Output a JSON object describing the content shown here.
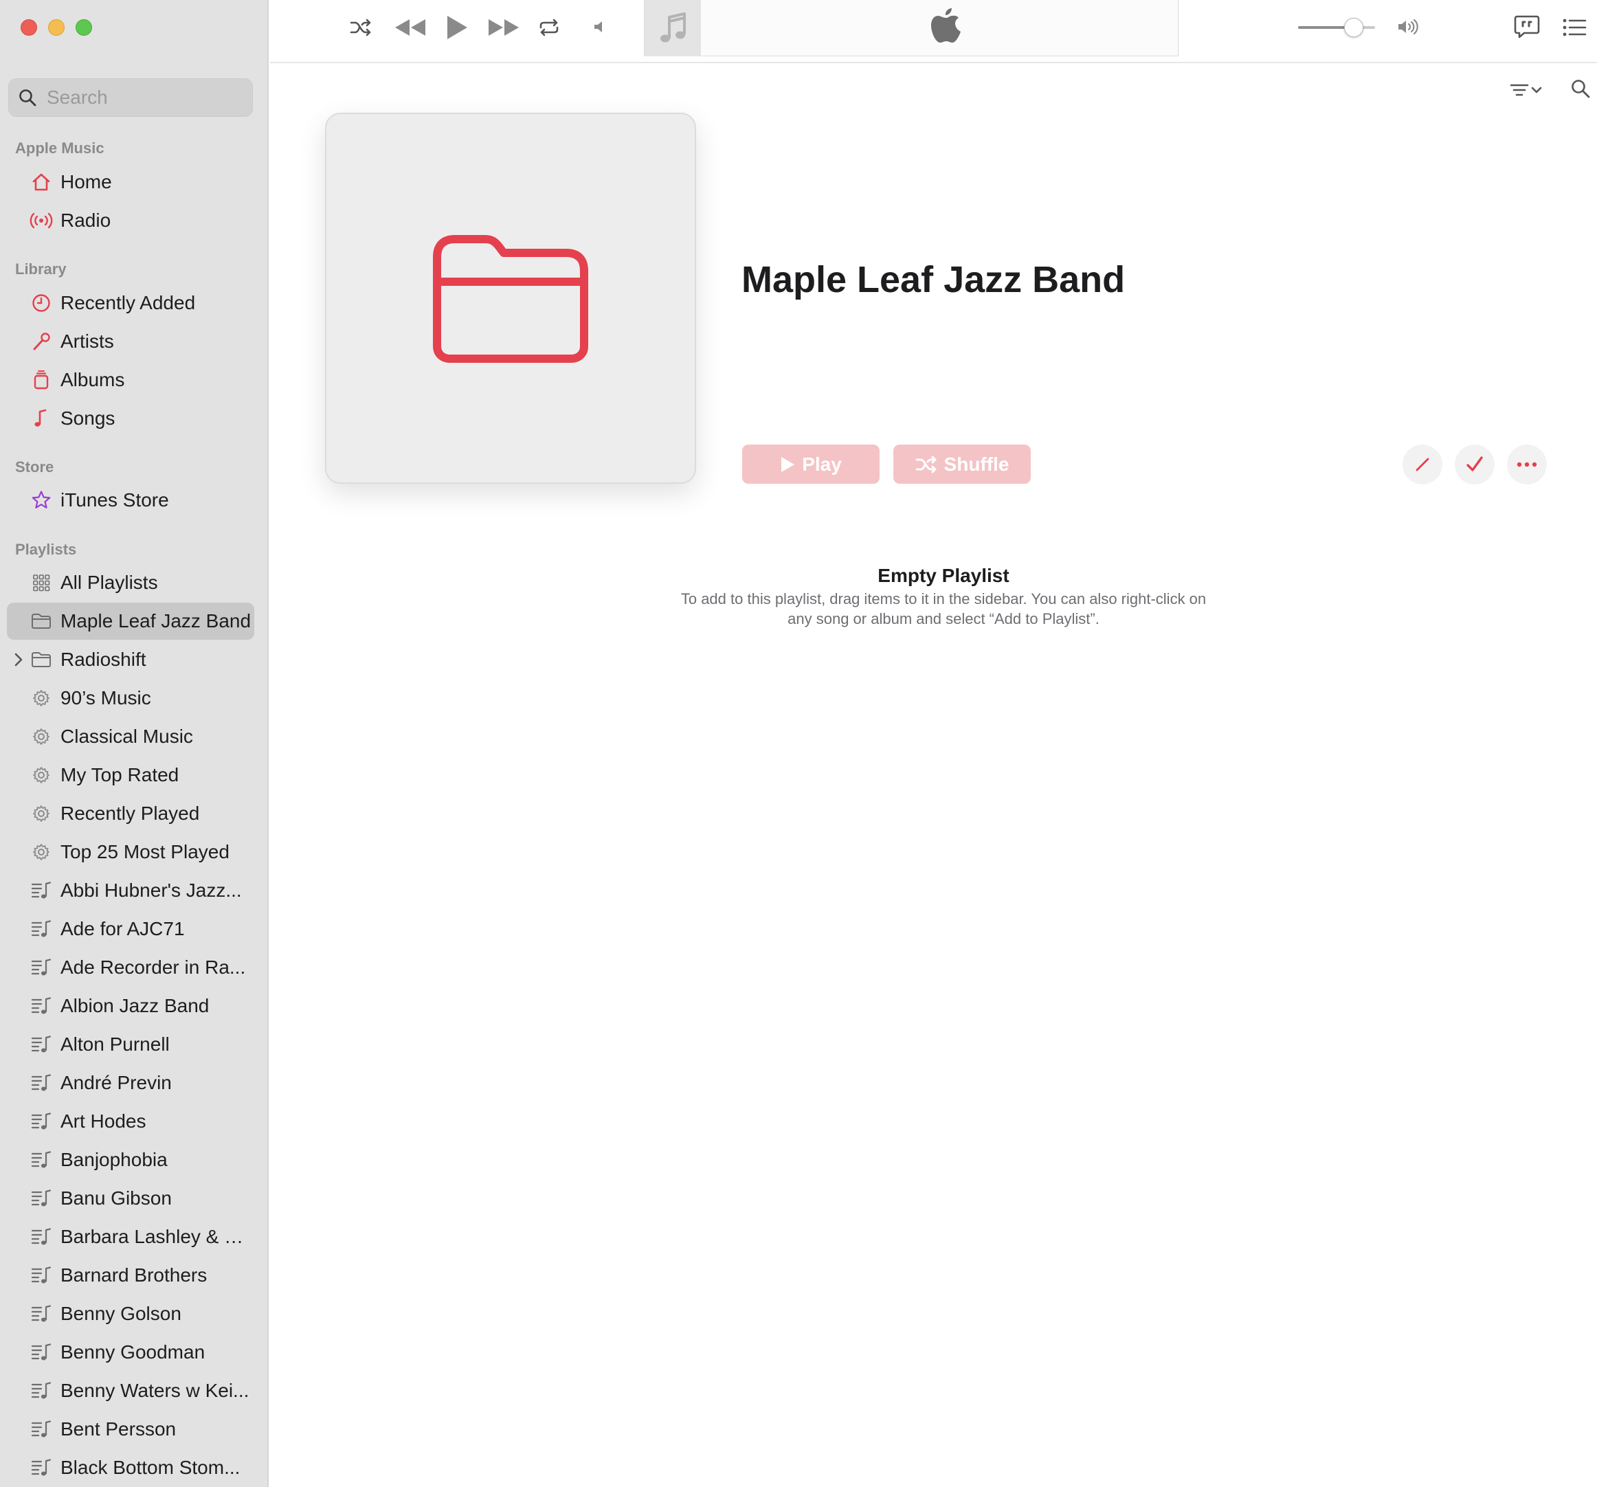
{
  "window": {
    "controls": [
      "close",
      "minimize",
      "maximize"
    ]
  },
  "sidebar": {
    "search_placeholder": "Search",
    "sections": {
      "apple_music": "Apple Music",
      "library": "Library",
      "store": "Store",
      "playlists": "Playlists"
    },
    "apple_music_items": [
      {
        "label": "Home",
        "icon": "house-icon"
      },
      {
        "label": "Radio",
        "icon": "radio-waves-icon"
      }
    ],
    "library_items": [
      {
        "label": "Recently Added",
        "icon": "clock-icon"
      },
      {
        "label": "Artists",
        "icon": "microphone-icon"
      },
      {
        "label": "Albums",
        "icon": "album-stack-icon"
      },
      {
        "label": "Songs",
        "icon": "music-note-icon"
      }
    ],
    "store_items": [
      {
        "label": "iTunes Store",
        "icon": "star-icon"
      }
    ],
    "playlist_items": [
      {
        "label": "All Playlists",
        "icon": "grid-icon"
      },
      {
        "label": "Maple Leaf Jazz Band",
        "icon": "folder-icon",
        "selected": true
      },
      {
        "label": "Radioshift",
        "icon": "folder-icon",
        "expandable": true
      },
      {
        "label": "90’s Music",
        "icon": "gear-icon"
      },
      {
        "label": "Classical Music",
        "icon": "gear-icon"
      },
      {
        "label": "My Top Rated",
        "icon": "gear-icon"
      },
      {
        "label": "Recently Played",
        "icon": "gear-icon"
      },
      {
        "label": "Top 25 Most Played",
        "icon": "gear-icon"
      },
      {
        "label": "Abbi Hubner's Jazz...",
        "icon": "playlist-icon"
      },
      {
        "label": "Ade for AJC71",
        "icon": "playlist-icon"
      },
      {
        "label": "Ade Recorder in Ra...",
        "icon": "playlist-icon"
      },
      {
        "label": "Albion Jazz Band",
        "icon": "playlist-icon"
      },
      {
        "label": "Alton Purnell",
        "icon": "playlist-icon"
      },
      {
        "label": "André Previn",
        "icon": "playlist-icon"
      },
      {
        "label": "Art Hodes",
        "icon": "playlist-icon"
      },
      {
        "label": "Banjophobia",
        "icon": "playlist-icon"
      },
      {
        "label": "Banu Gibson",
        "icon": "playlist-icon"
      },
      {
        "label": "Barbara Lashley & R...",
        "icon": "playlist-icon"
      },
      {
        "label": "Barnard Brothers",
        "icon": "playlist-icon"
      },
      {
        "label": "Benny Golson",
        "icon": "playlist-icon"
      },
      {
        "label": "Benny Goodman",
        "icon": "playlist-icon"
      },
      {
        "label": "Benny Waters w Kei...",
        "icon": "playlist-icon"
      },
      {
        "label": "Bent Persson",
        "icon": "playlist-icon"
      },
      {
        "label": "Black Bottom Stom...",
        "icon": "playlist-icon"
      }
    ]
  },
  "toolbar": {
    "volume_level": 0.72,
    "icons": [
      "shuffle-icon",
      "rewind-icon",
      "play-icon",
      "fast-forward-icon",
      "repeat-icon",
      "music-note-icon",
      "apple-logo-icon",
      "volume-low-icon",
      "volume-high-icon",
      "lyrics-icon",
      "queue-list-icon"
    ]
  },
  "main": {
    "title": "Maple Leaf Jazz Band",
    "play_label": "Play",
    "shuffle_label": "Shuffle",
    "empty_title": "Empty Playlist",
    "empty_description": "To add to this playlist, drag items to it in the sidebar. You can also right-click on any song or album and select “Add to Playlist”."
  },
  "colors": {
    "accent": "#e5404d",
    "sidebar_bg": "#e3e2e2",
    "selected_row": "#c9c8c8",
    "disabled_button": "#f4c3c6",
    "store_icon": "#9b3cd6"
  }
}
